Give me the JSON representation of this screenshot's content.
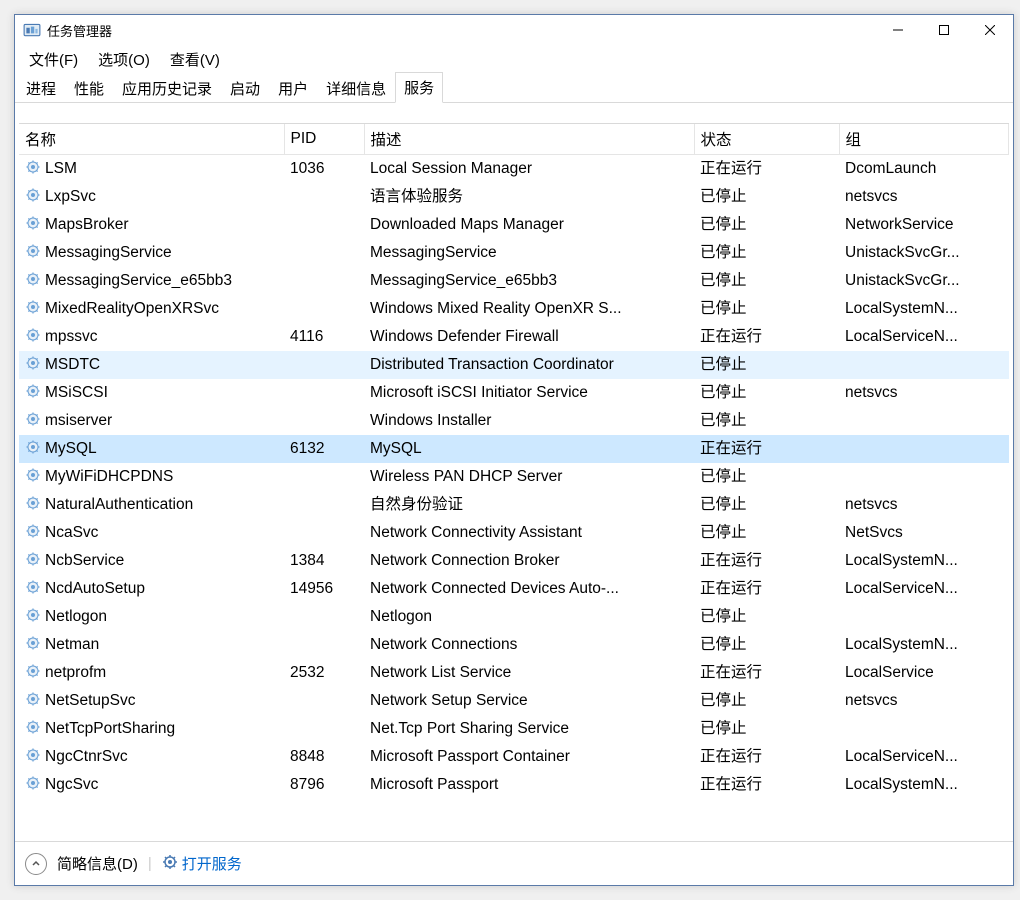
{
  "window": {
    "title": "任务管理器"
  },
  "menu": {
    "file": "文件(F)",
    "options": "选项(O)",
    "view": "查看(V)"
  },
  "tabs": [
    {
      "label": "进程"
    },
    {
      "label": "性能"
    },
    {
      "label": "应用历史记录"
    },
    {
      "label": "启动"
    },
    {
      "label": "用户"
    },
    {
      "label": "详细信息"
    },
    {
      "label": "服务",
      "active": true
    }
  ],
  "columns": {
    "name": "名称",
    "pid": "PID",
    "desc": "描述",
    "status": "状态",
    "group": "组"
  },
  "rows": [
    {
      "name": "LSM",
      "pid": "1036",
      "desc": "Local Session Manager",
      "status": "正在运行",
      "group": "DcomLaunch"
    },
    {
      "name": "LxpSvc",
      "pid": "",
      "desc": "语言体验服务",
      "status": "已停止",
      "group": "netsvcs"
    },
    {
      "name": "MapsBroker",
      "pid": "",
      "desc": "Downloaded Maps Manager",
      "status": "已停止",
      "group": "NetworkService"
    },
    {
      "name": "MessagingService",
      "pid": "",
      "desc": "MessagingService",
      "status": "已停止",
      "group": "UnistackSvcGr..."
    },
    {
      "name": "MessagingService_e65bb3",
      "pid": "",
      "desc": "MessagingService_e65bb3",
      "status": "已停止",
      "group": "UnistackSvcGr..."
    },
    {
      "name": "MixedRealityOpenXRSvc",
      "pid": "",
      "desc": "Windows Mixed Reality OpenXR S...",
      "status": "已停止",
      "group": "LocalSystemN..."
    },
    {
      "name": "mpssvc",
      "pid": "4116",
      "desc": "Windows Defender Firewall",
      "status": "正在运行",
      "group": "LocalServiceN..."
    },
    {
      "name": "MSDTC",
      "pid": "",
      "desc": "Distributed Transaction Coordinator",
      "status": "已停止",
      "group": "",
      "hover": true
    },
    {
      "name": "MSiSCSI",
      "pid": "",
      "desc": "Microsoft iSCSI Initiator Service",
      "status": "已停止",
      "group": "netsvcs"
    },
    {
      "name": "msiserver",
      "pid": "",
      "desc": "Windows Installer",
      "status": "已停止",
      "group": ""
    },
    {
      "name": "MySQL",
      "pid": "6132",
      "desc": "MySQL",
      "status": "正在运行",
      "group": "",
      "selected": true
    },
    {
      "name": "MyWiFiDHCPDNS",
      "pid": "",
      "desc": "Wireless PAN DHCP Server",
      "status": "已停止",
      "group": ""
    },
    {
      "name": "NaturalAuthentication",
      "pid": "",
      "desc": "自然身份验证",
      "status": "已停止",
      "group": "netsvcs"
    },
    {
      "name": "NcaSvc",
      "pid": "",
      "desc": "Network Connectivity Assistant",
      "status": "已停止",
      "group": "NetSvcs"
    },
    {
      "name": "NcbService",
      "pid": "1384",
      "desc": "Network Connection Broker",
      "status": "正在运行",
      "group": "LocalSystemN..."
    },
    {
      "name": "NcdAutoSetup",
      "pid": "14956",
      "desc": "Network Connected Devices Auto-...",
      "status": "正在运行",
      "group": "LocalServiceN..."
    },
    {
      "name": "Netlogon",
      "pid": "",
      "desc": "Netlogon",
      "status": "已停止",
      "group": ""
    },
    {
      "name": "Netman",
      "pid": "",
      "desc": "Network Connections",
      "status": "已停止",
      "group": "LocalSystemN..."
    },
    {
      "name": "netprofm",
      "pid": "2532",
      "desc": "Network List Service",
      "status": "正在运行",
      "group": "LocalService"
    },
    {
      "name": "NetSetupSvc",
      "pid": "",
      "desc": "Network Setup Service",
      "status": "已停止",
      "group": "netsvcs"
    },
    {
      "name": "NetTcpPortSharing",
      "pid": "",
      "desc": "Net.Tcp Port Sharing Service",
      "status": "已停止",
      "group": ""
    },
    {
      "name": "NgcCtnrSvc",
      "pid": "8848",
      "desc": "Microsoft Passport Container",
      "status": "正在运行",
      "group": "LocalServiceN..."
    },
    {
      "name": "NgcSvc",
      "pid": "8796",
      "desc": "Microsoft Passport",
      "status": "正在运行",
      "group": "LocalSystemN..."
    }
  ],
  "footer": {
    "brief": "简略信息(D)",
    "open_services": "打开服务"
  }
}
